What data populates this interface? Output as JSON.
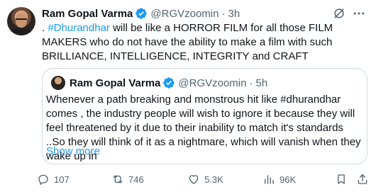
{
  "tweet": {
    "author_name": "Ram Gopal Varma",
    "handle": "@RGVzoomin",
    "separator": "·",
    "time": "3h",
    "text_prefix": ". ",
    "hashtag": "#Dhurandhar",
    "text_rest": " will be like a HORROR FILM for all those FILM MAKERS  who do not have the ability to make a film with such BRILLIANCE, INTELLIGENCE, INTEGRITY and CRAFT"
  },
  "quote": {
    "author_name": "Ram Gopal Varma",
    "handle": "@RGVzoomin",
    "separator": "·",
    "time": "5h",
    "text": "Whenever a path breaking and monstrous hit  like #dhurandhar comes , the industry people will wish to ignore it because they will feel threatened by it due to their inability to match it's standards ..So they will think of it as a nightmare, which will vanish when they wake up in",
    "show_more": "Show more"
  },
  "actions": {
    "replies": "107",
    "reposts": "746",
    "likes": "5.3K",
    "views": "96K"
  },
  "colors": {
    "accent": "#1d9bf0",
    "muted": "#536471",
    "text": "#0f1419",
    "border": "#cfd9de"
  },
  "icons": [
    "verified-badge-icon",
    "grok-icon",
    "more-icon",
    "reply-icon",
    "repost-icon",
    "like-icon",
    "views-icon",
    "bookmark-icon",
    "share-icon"
  ]
}
